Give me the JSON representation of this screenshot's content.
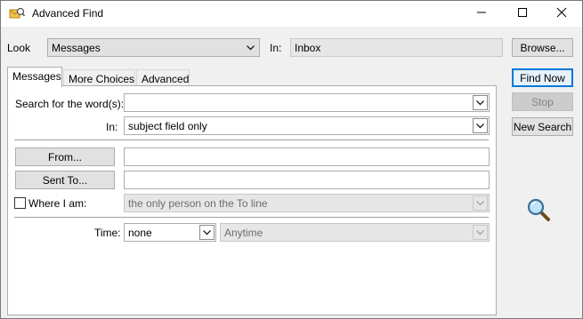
{
  "window": {
    "title": "Advanced Find",
    "icons": {
      "app": "advanced-find-icon",
      "minimize": "minimize-icon",
      "maximize": "maximize-icon",
      "close": "close-icon"
    }
  },
  "top": {
    "look_label": "Look",
    "look_value": "Messages",
    "in_label": "In:",
    "in_value": "Inbox",
    "browse_label": "Browse..."
  },
  "tabs": [
    {
      "label": "Messages",
      "active": true
    },
    {
      "label": "More Choices",
      "active": false
    },
    {
      "label": "Advanced",
      "active": false
    }
  ],
  "messages_tab": {
    "search_words_label": "Search for the word(s):",
    "search_words_value": "",
    "in_label": "In:",
    "in_value": "subject field only",
    "from_label": "From...",
    "from_value": "",
    "sent_to_label": "Sent To...",
    "sent_to_value": "",
    "where_i_am_label": "Where I am:",
    "where_i_am_checked": false,
    "where_i_am_value": "the only person on the To line",
    "time_label": "Time:",
    "time_value": "none",
    "time_range_value": "Anytime"
  },
  "actions": {
    "find_now": "Find Now",
    "stop": "Stop",
    "new_search": "New Search",
    "search_icon": "magnifier-icon"
  },
  "colors": {
    "accent": "#0078d7",
    "panel_bg": "#ffffff",
    "window_bg": "#f0f0f0"
  }
}
